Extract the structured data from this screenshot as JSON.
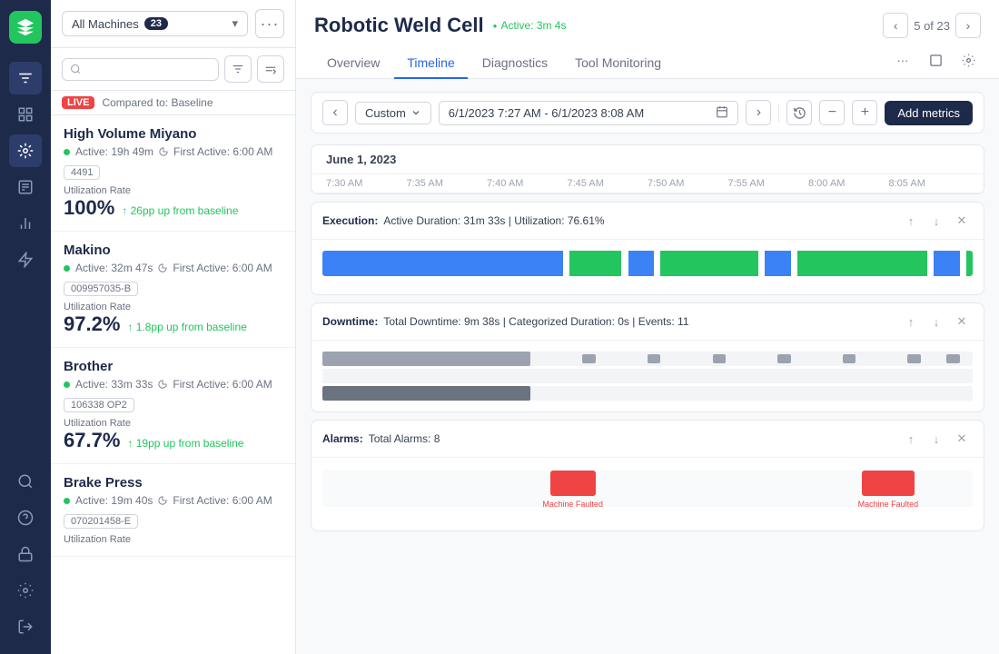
{
  "sidebar": {
    "logo_alt": "App Logo",
    "nav_items": [
      {
        "id": "filter",
        "icon": "≋",
        "active": false
      },
      {
        "id": "dashboard",
        "icon": "▦",
        "active": false
      },
      {
        "id": "machines",
        "icon": "⚙",
        "active": true
      },
      {
        "id": "list",
        "icon": "☰",
        "active": false
      },
      {
        "id": "chart",
        "icon": "📊",
        "active": false
      },
      {
        "id": "alerts",
        "icon": "⚡",
        "active": false
      }
    ],
    "bottom_items": [
      {
        "id": "search",
        "icon": "🔍"
      },
      {
        "id": "help",
        "icon": "?"
      },
      {
        "id": "lock",
        "icon": "🔒"
      },
      {
        "id": "settings",
        "icon": "⚙"
      },
      {
        "id": "logout",
        "icon": "→"
      }
    ]
  },
  "machine_panel": {
    "selector_label": "All Machines",
    "selector_count": "23",
    "live_label": "LIVE",
    "compared_label": "Compared to: Baseline",
    "search_placeholder": "",
    "machines": [
      {
        "name": "High Volume Miyano",
        "status": "Active: 19h 49m",
        "first_active": "First Active: 6:00 AM",
        "tag": "4491",
        "util_label": "Utilization Rate",
        "util_value": "100%",
        "util_change": "26pp up from baseline"
      },
      {
        "name": "Makino",
        "status": "Active: 32m 47s",
        "first_active": "First Active: 6:00 AM",
        "tag": "009957035-B",
        "util_label": "Utilization Rate",
        "util_value": "97.2%",
        "util_change": "1.8pp up from baseline"
      },
      {
        "name": "Brother",
        "status": "Active: 33m 33s",
        "first_active": "First Active: 6:00 AM",
        "tag": "106338 OP2",
        "util_label": "Utilization Rate",
        "util_value": "67.7%",
        "util_change": "19pp up from baseline"
      },
      {
        "name": "Brake Press",
        "status": "Active: 19m 40s",
        "first_active": "First Active: 6:00 AM",
        "tag": "070201458-E",
        "util_label": "Utilization Rate",
        "util_value": "",
        "util_change": ""
      }
    ]
  },
  "main": {
    "machine_title": "Robotic Weld Cell",
    "machine_active": "Active: 3m 4s",
    "nav_position": "5 of 23",
    "tabs": [
      "Overview",
      "Timeline",
      "Diagnostics",
      "Tool Monitoring"
    ],
    "active_tab": "Timeline",
    "toolbar": {
      "custom_label": "Custom",
      "date_range": "6/1/2023 7:27 AM - 6/1/2023 8:08 AM",
      "add_metrics_label": "Add metrics"
    },
    "chart_date": "June 1, 2023",
    "time_labels": [
      "7:30 AM",
      "7:35 AM",
      "7:40 AM",
      "7:45 AM",
      "7:50 AM",
      "7:55 AM",
      "8:00 AM",
      "8:05 AM"
    ],
    "metrics": [
      {
        "id": "execution",
        "title": "Execution:",
        "stats": "Active Duration: 31m 33s  |  Utilization: 76.61%",
        "type": "execution"
      },
      {
        "id": "downtime",
        "title": "Downtime:",
        "stats": "Total Downtime: 9m 38s  |  Categorized Duration: 0s  |  Events: 11",
        "type": "downtime"
      },
      {
        "id": "alarms",
        "title": "Alarms:",
        "stats": "Total Alarms: 8",
        "type": "alarms"
      }
    ]
  }
}
